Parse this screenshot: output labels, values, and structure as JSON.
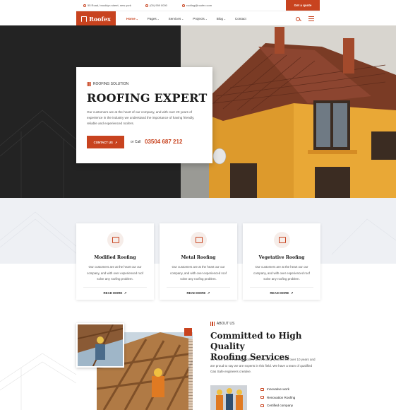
{
  "topbar": {
    "address": "55 Road, brooklyn street, new york",
    "phone": "(00) 959 0000",
    "email": "roofing@roofex.com",
    "quote_label": "Get a quote"
  },
  "navbar": {
    "logo": "Roofex",
    "items": [
      {
        "label": "Home",
        "caret": "⌄"
      },
      {
        "label": "Pages",
        "caret": "⌄"
      },
      {
        "label": "Services",
        "caret": "⌄"
      },
      {
        "label": "Projects",
        "caret": "⌄"
      },
      {
        "label": "Blog",
        "caret": "⌄"
      },
      {
        "label": "Contact",
        "caret": ""
      }
    ]
  },
  "hero": {
    "eyebrow": "ROOFING SOLUTION",
    "title": "ROOFING EXPERT",
    "text": "Our customers are at the heart of our company, and with over 20 years of experience in the industry we understand the importance of having friendly, reliable and experienced roofers.",
    "button": "CONTACT US",
    "button_arrow": "↗",
    "or_call": "or Call",
    "phone": "03504 687 212"
  },
  "services": [
    {
      "title": "Modified Roofing",
      "text": "Our customers are at the heart our our company, and with over experienced roof solve any roofing problem.",
      "link": "READ MORE",
      "arrow": "↗"
    },
    {
      "title": "Metal Roofing",
      "text": "Our customers are at the heart our our company, and with over experienced roof solve any roofing problem.",
      "link": "READ MORE",
      "arrow": "↗"
    },
    {
      "title": "Vegetative Roofing",
      "text": "Our customers are at the heart our our company, and with over experienced roof solve any roofing problem.",
      "link": "READ MORE",
      "arrow": "↗"
    }
  ],
  "about": {
    "eyebrow": "ABOUT US",
    "title_line1": "Committed to High Quality",
    "title_line2": "Roofing Services",
    "text": "We have been installing boilers and heating systems for over 10 years and are proud to say we are experts in this field. We have a team of qualified Gas Safe engineers creative.",
    "features": [
      "Innovative work",
      "Renovation Roofing",
      "Certified company"
    ]
  },
  "colors": {
    "accent": "#c8431f",
    "dark": "#232323",
    "band": "#eef0f4"
  }
}
